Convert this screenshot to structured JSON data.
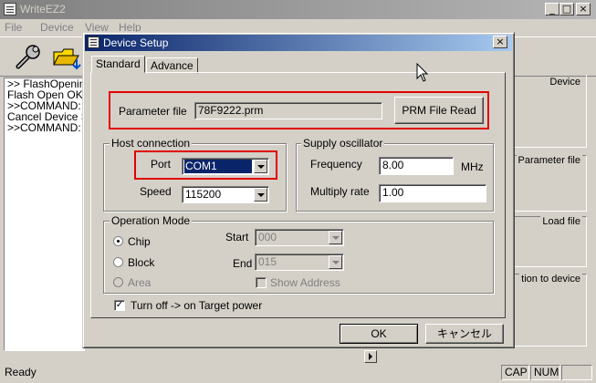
{
  "app": {
    "title": "WriteEZ2",
    "menu": [
      "File",
      "Device",
      "View",
      "Help"
    ],
    "log_lines": [
      ">> FlashOpening",
      "Flash Open OK",
      ">>COMMAND: D",
      "Cancel Device S",
      ">>COMMAND: D"
    ],
    "right_panel": [
      "Device",
      "Parameter file",
      "Load file",
      "tion to device"
    ],
    "status": {
      "text": "Ready",
      "cap": "CAP",
      "num": "NUM"
    }
  },
  "dialog": {
    "title": "Device Setup",
    "tabs": [
      "Standard",
      "Advance"
    ],
    "parameter_file": {
      "label": "Parameter file",
      "value": "78F9222.prm",
      "button": "PRM File Read"
    },
    "host": {
      "group": "Host connection",
      "port_label": "Port",
      "port_value": "COM1",
      "speed_label": "Speed",
      "speed_value": "115200"
    },
    "osc": {
      "group": "Supply oscillator",
      "freq_label": "Frequency",
      "freq_value": "8.00",
      "freq_unit": "MHz",
      "mult_label": "Multiply rate",
      "mult_value": "1.00"
    },
    "op": {
      "group": "Operation Mode",
      "chip": "Chip",
      "block": "Block",
      "area": "Area",
      "start_label": "Start",
      "start_value": "000",
      "end_label": "End",
      "end_value": "015",
      "show_address": "Show Address"
    },
    "turn_off": "Turn off -> on Target power",
    "ok": "OK",
    "cancel": "キャンセル"
  }
}
